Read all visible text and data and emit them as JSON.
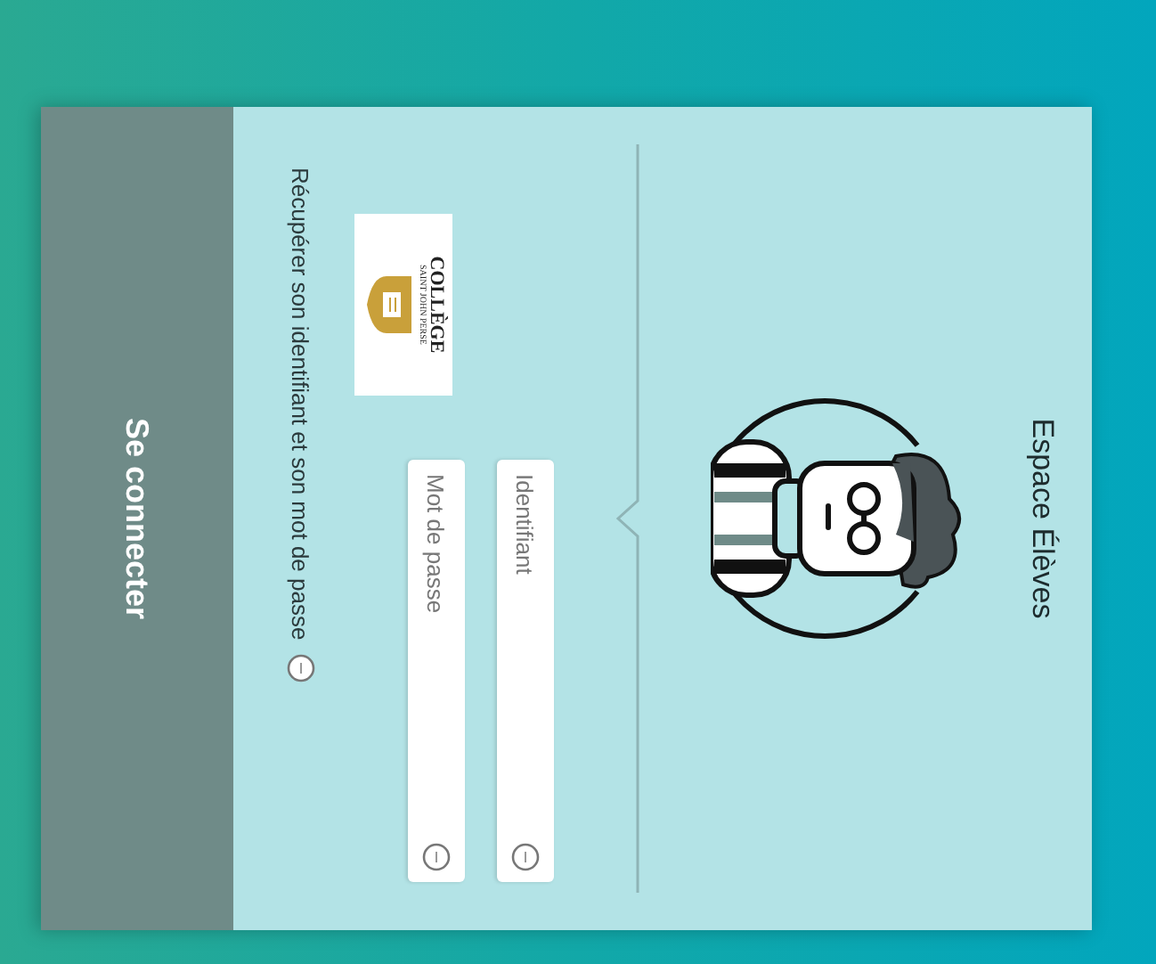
{
  "title": "Espace Élèves",
  "logo": {
    "name": "COLLÈGE",
    "subtitle": "SAINT JOHN PERSE"
  },
  "fields": [
    {
      "placeholder": "Identifiant"
    },
    {
      "placeholder": "Mot de passe"
    }
  ],
  "recover_link": "Récupérer son identifiant et son mot de passe",
  "submit": "Se connecter"
}
